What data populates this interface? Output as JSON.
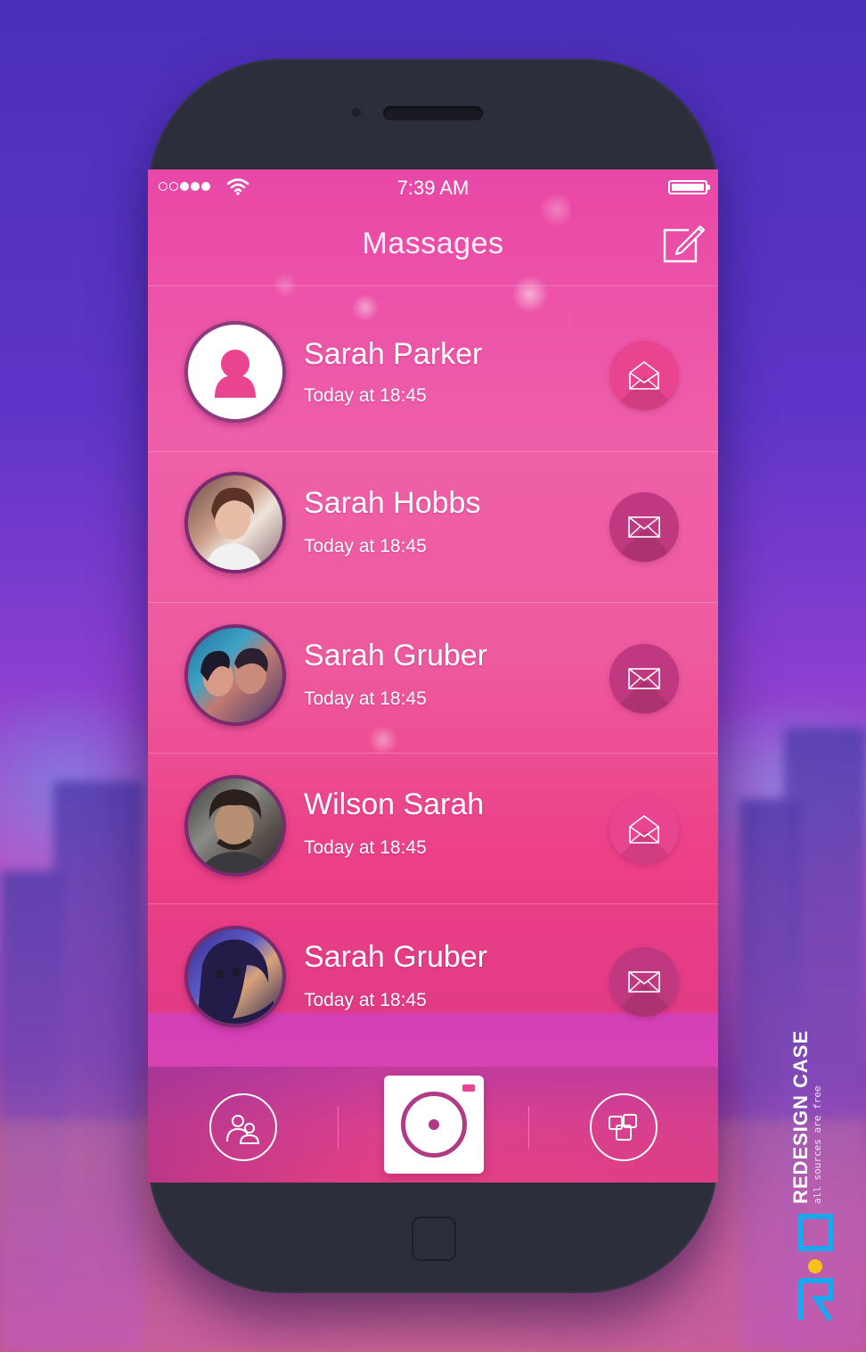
{
  "status_bar": {
    "time": "7:39 AM",
    "signal_dots": [
      "empty",
      "empty",
      "full",
      "full",
      "full"
    ]
  },
  "nav": {
    "title": "Massages",
    "compose_icon": "compose-icon"
  },
  "messages": [
    {
      "name": "Sarah Parker",
      "time": "Today at 18:45",
      "avatar": "default-user-icon",
      "status": "open",
      "icon": "open-envelope-icon"
    },
    {
      "name": "Sarah Hobbs",
      "time": "Today at 18:45",
      "avatar": "photo",
      "status": "closed",
      "icon": "envelope-icon"
    },
    {
      "name": "Sarah Gruber",
      "time": "Today at 18:45",
      "avatar": "photo",
      "status": "closed",
      "icon": "envelope-icon"
    },
    {
      "name": "Wilson Sarah",
      "time": "Today at 18:45",
      "avatar": "photo",
      "status": "open",
      "icon": "open-envelope-icon"
    },
    {
      "name": "Sarah Gruber",
      "time": "Today at 18:45",
      "avatar": "photo",
      "status": "closed",
      "icon": "envelope-icon"
    }
  ],
  "tab_bar": {
    "left_icon": "contacts-icon",
    "center_icon": "camera-icon",
    "right_icon": "apps-icon"
  },
  "watermark": {
    "title": "REDESIGN CASE",
    "subtitle": "all sources are free"
  },
  "colors": {
    "accent_pink": "#e8448f",
    "accent_plum": "#b03a86",
    "phone_body": "#2c2e3b"
  }
}
